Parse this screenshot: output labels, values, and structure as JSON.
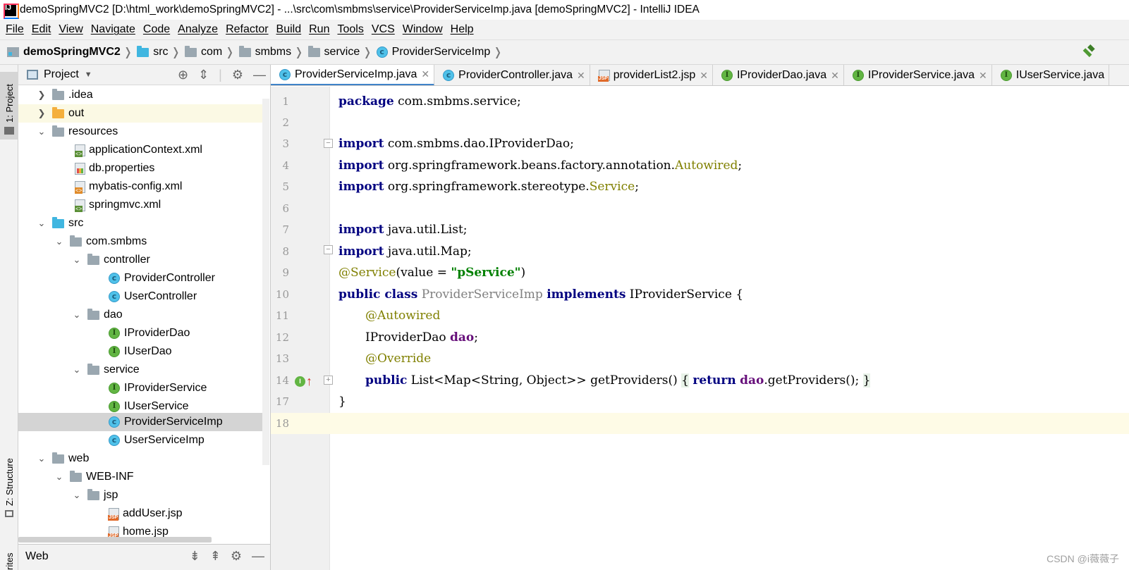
{
  "window": {
    "title": "demoSpringMVC2 [D:\\html_work\\demoSpringMVC2] - ...\\src\\com\\smbms\\service\\ProviderServiceImp.java [demoSpringMVC2] - IntelliJ IDEA"
  },
  "menu": [
    "File",
    "Edit",
    "View",
    "Navigate",
    "Code",
    "Analyze",
    "Refactor",
    "Build",
    "Run",
    "Tools",
    "VCS",
    "Window",
    "Help"
  ],
  "breadcrumb": [
    "demoSpringMVC2",
    "src",
    "com",
    "smbms",
    "service",
    "ProviderServiceImp"
  ],
  "toolstrip": {
    "project_tab": "1: Project",
    "structure_tab": "Z: Structure",
    "favorites_tab": "rites"
  },
  "project_panel": {
    "title": "Project",
    "tree": [
      {
        "label": ".idea",
        "icon": "folder-icon",
        "expanded": false
      },
      {
        "label": "out",
        "icon": "folder-orange-icon",
        "expanded": false
      },
      {
        "label": "resources",
        "icon": "resources-folder-icon",
        "expanded": true
      },
      {
        "label": "applicationContext.xml",
        "icon": "xml-file-icon"
      },
      {
        "label": "db.properties",
        "icon": "properties-file-icon"
      },
      {
        "label": "mybatis-config.xml",
        "icon": "xml-file-icon"
      },
      {
        "label": "springmvc.xml",
        "icon": "xml-file-icon"
      },
      {
        "label": "src",
        "icon": "source-folder-icon",
        "expanded": true
      },
      {
        "label": "com.smbms",
        "icon": "package-icon",
        "expanded": true
      },
      {
        "label": "controller",
        "icon": "package-icon",
        "expanded": true
      },
      {
        "label": "ProviderController",
        "icon": "class-icon"
      },
      {
        "label": "UserController",
        "icon": "class-icon"
      },
      {
        "label": "dao",
        "icon": "package-icon",
        "expanded": true
      },
      {
        "label": "IProviderDao",
        "icon": "interface-icon"
      },
      {
        "label": "IUserDao",
        "icon": "interface-icon"
      },
      {
        "label": "service",
        "icon": "package-icon",
        "expanded": true
      },
      {
        "label": "IProviderService",
        "icon": "interface-icon"
      },
      {
        "label": "IUserService",
        "icon": "interface-icon"
      },
      {
        "label": "ProviderServiceImp",
        "icon": "class-icon",
        "selected": true
      },
      {
        "label": "UserServiceImp",
        "icon": "class-icon"
      },
      {
        "label": "web",
        "icon": "web-folder-icon",
        "expanded": true
      },
      {
        "label": "WEB-INF",
        "icon": "folder-icon",
        "expanded": true
      },
      {
        "label": "jsp",
        "icon": "folder-icon",
        "expanded": true
      },
      {
        "label": "addUser.jsp",
        "icon": "jsp-file-icon"
      },
      {
        "label": "home.jsp",
        "icon": "jsp-file-icon"
      }
    ]
  },
  "web_panel": {
    "title": "Web"
  },
  "tabs": [
    {
      "label": "ProviderServiceImp.java",
      "icon": "class-icon",
      "active": true
    },
    {
      "label": "ProviderController.java",
      "icon": "class-icon"
    },
    {
      "label": "providerList2.jsp",
      "icon": "jsp-file-icon"
    },
    {
      "label": "IProviderDao.java",
      "icon": "interface-icon"
    },
    {
      "label": "IProviderService.java",
      "icon": "interface-icon"
    },
    {
      "label": "IUserService.java",
      "icon": "interface-icon"
    }
  ],
  "editor": {
    "line_numbers": [
      "1",
      "2",
      "3",
      "4",
      "5",
      "6",
      "7",
      "8",
      "9",
      "10",
      "11",
      "12",
      "13",
      "14",
      "17",
      "18"
    ],
    "lines": {
      "l1_kw": "package",
      "l1_rest": " com.smbms.service;",
      "l3_kw": "import",
      "l3_rest": " com.smbms.dao.IProviderDao;",
      "l4_kw": "import",
      "l4_rest": " org.springframework.beans.factory.annotation.",
      "l4_ann": "Autowired",
      "l4_end": ";",
      "l5_kw": "import",
      "l5_rest": " org.springframework.stereotype.",
      "l5_ann": "Service",
      "l5_end": ";",
      "l7_kw": "import",
      "l7_rest": " java.util.List;",
      "l8_kw": "import",
      "l8_rest": " java.util.Map;",
      "l9_ann": "@Service",
      "l9_rest": "(value = ",
      "l9_str": "\"pService\"",
      "l9_end": ")",
      "l10_kw1": "public class",
      "l10_name": " ProviderServiceImp ",
      "l10_kw2": "implements",
      "l10_rest": " IProviderService {",
      "l11_ann": "@Autowired",
      "l12_type": "IProviderDao ",
      "l12_fld": "dao",
      "l12_end": ";",
      "l13_ann": "@Override",
      "l14_kw": "public",
      "l14_sig": " List<Map<String, Object>> getProviders() ",
      "l14_open": "{",
      "l14_ret": "return",
      "l14_fld": "dao",
      "l14_call": ".getProviders();",
      "l14_close": "}",
      "l17": "}"
    }
  },
  "watermark": "CSDN @i薇薇子"
}
